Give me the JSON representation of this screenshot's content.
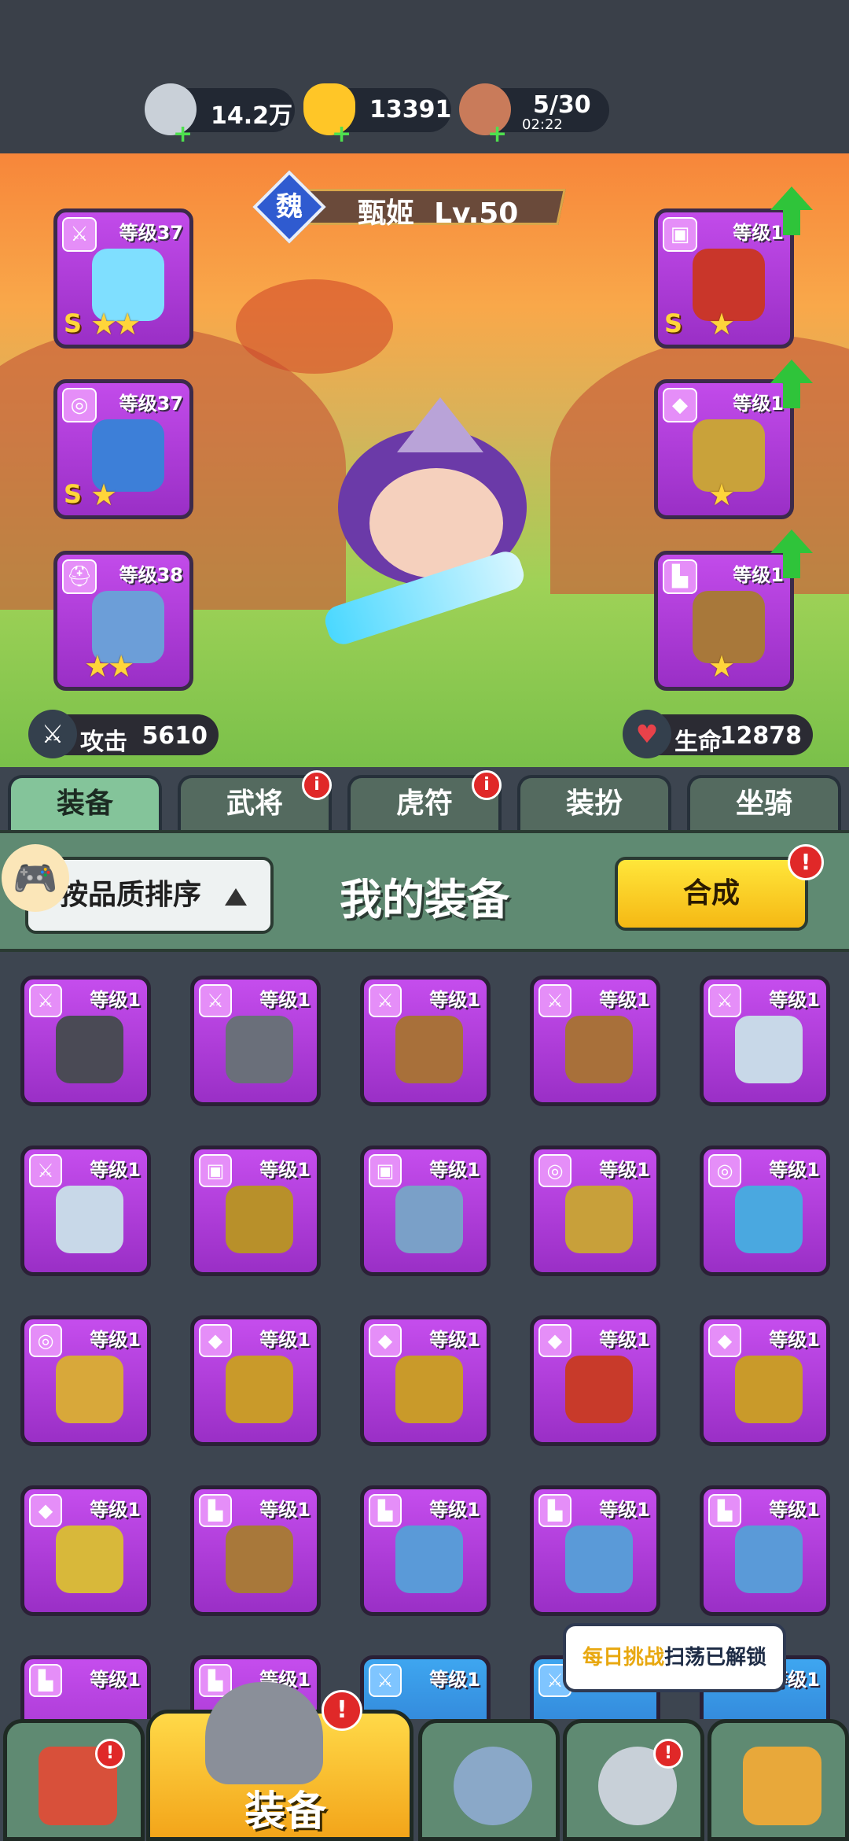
{
  "currency": {
    "silver": "14.2万",
    "gold": "13391",
    "stamina": "5/30",
    "stamina_timer": "02:22",
    "plus": "+"
  },
  "hero": {
    "kingdom": "魏",
    "name": "甄姬",
    "level": "Lv.50",
    "attack_label": "攻击",
    "attack_value": "5610",
    "hp_label": "生命",
    "hp_value": "12878"
  },
  "equipped": {
    "weapon": {
      "level": "等级37",
      "grade": "S",
      "stars": "★★"
    },
    "necklace": {
      "level": "等级37",
      "grade": "S",
      "stars": "★"
    },
    "helmet": {
      "level": "等级38",
      "grade": "",
      "stars": "★★"
    },
    "armor": {
      "level": "等级1",
      "grade": "S",
      "stars": "★"
    },
    "bracer": {
      "level": "等级1",
      "grade": "",
      "stars": "★"
    },
    "boots": {
      "level": "等级1",
      "grade": "",
      "stars": "★"
    }
  },
  "tabs": [
    "装备",
    "武将",
    "虎符",
    "装扮",
    "坐骑"
  ],
  "badge": "i",
  "alert": "!",
  "inventory": {
    "sort_label": "按品质排序",
    "title": "我的装备",
    "synth_label": "合成",
    "item_level": "等级1"
  },
  "tooltip": {
    "highlight": "每日挑战",
    "rest": "扫荡已解锁"
  },
  "nav": {
    "equip_label": "装备"
  },
  "colors": {
    "purple_rarity": "#b03fdc",
    "blue_rarity": "#3a8ee0",
    "tab_active": "#84c49a",
    "synth_btn": "#f9c81f"
  }
}
